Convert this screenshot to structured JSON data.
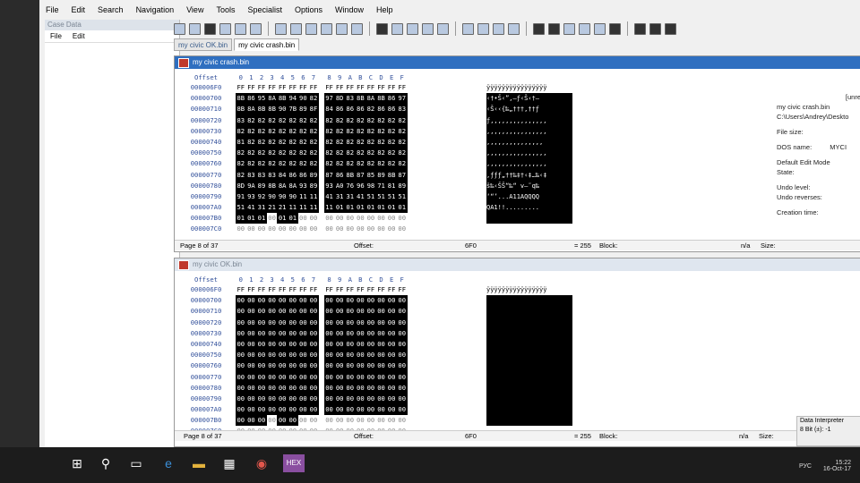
{
  "menu": [
    "File",
    "Edit",
    "Search",
    "Navigation",
    "View",
    "Tools",
    "Specialist",
    "Options",
    "Window",
    "Help"
  ],
  "sidebar": {
    "title": "Case Data",
    "menu": [
      "File",
      "Edit"
    ]
  },
  "tabs": [
    "my civic OK.bin",
    "my civic crash.bin"
  ],
  "top": {
    "title": "my civic crash.bin",
    "header": [
      "0",
      "1",
      "2",
      "3",
      "4",
      "5",
      "6",
      "7",
      "8",
      "9",
      "A",
      "B",
      "C",
      "D",
      "E",
      "F"
    ],
    "offset_label": "Offset",
    "rows": [
      {
        "off": "000006F0",
        "b": [
          "FF",
          "FF",
          "FF",
          "FF",
          "FF",
          "FF",
          "FF",
          "FF",
          "FF",
          "FF",
          "FF",
          "FF",
          "FF",
          "FF",
          "FF",
          "FF"
        ],
        "t": "ÿÿÿÿÿÿÿÿÿÿÿÿÿÿÿÿ"
      },
      {
        "off": "00000700",
        "b": [
          "8B",
          "86",
          "95",
          "8A",
          "8B",
          "94",
          "90",
          "82",
          "97",
          "8D",
          "83",
          "8B",
          "8A",
          "8B",
          "86",
          "97"
        ],
        "t": "‹†•Š‹”‚—ƒ‹Š‹†—"
      },
      {
        "off": "00000710",
        "b": [
          "8B",
          "8A",
          "8B",
          "8B",
          "90",
          "7B",
          "89",
          "8F",
          "84",
          "86",
          "86",
          "86",
          "82",
          "86",
          "86",
          "83"
        ],
        "t": "‹Š‹‹{‰„†††‚††ƒ"
      },
      {
        "off": "00000720",
        "b": [
          "83",
          "82",
          "82",
          "82",
          "82",
          "82",
          "82",
          "82",
          "82",
          "82",
          "82",
          "82",
          "82",
          "82",
          "82",
          "82"
        ],
        "t": "ƒ‚‚‚‚‚‚‚‚‚‚‚‚‚‚‚"
      },
      {
        "off": "00000730",
        "b": [
          "82",
          "82",
          "82",
          "82",
          "82",
          "82",
          "82",
          "82",
          "82",
          "82",
          "82",
          "82",
          "82",
          "82",
          "82",
          "82"
        ],
        "t": "‚‚‚‚‚‚‚‚‚‚‚‚‚‚‚‚"
      },
      {
        "off": "00000740",
        "b": [
          "81",
          "82",
          "82",
          "82",
          "82",
          "82",
          "82",
          "82",
          "82",
          "82",
          "82",
          "82",
          "82",
          "82",
          "82",
          "82"
        ],
        "t": "‚‚‚‚‚‚‚‚‚‚‚‚‚‚‚"
      },
      {
        "off": "00000750",
        "b": [
          "82",
          "82",
          "82",
          "82",
          "82",
          "82",
          "82",
          "82",
          "82",
          "82",
          "82",
          "82",
          "82",
          "82",
          "82",
          "82"
        ],
        "t": "‚‚‚‚‚‚‚‚‚‚‚‚‚‚‚‚"
      },
      {
        "off": "00000760",
        "b": [
          "82",
          "82",
          "82",
          "82",
          "82",
          "82",
          "82",
          "82",
          "82",
          "82",
          "82",
          "82",
          "82",
          "82",
          "82",
          "82"
        ],
        "t": "‚‚‚‚‚‚‚‚‚‚‚‚‚‚‚‚"
      },
      {
        "off": "00000770",
        "b": [
          "82",
          "83",
          "83",
          "83",
          "84",
          "86",
          "86",
          "89",
          "87",
          "86",
          "8B",
          "87",
          "85",
          "89",
          "8B",
          "87"
        ],
        "t": "‚ƒƒƒ„††‰‡†‹‡…‰‹‡"
      },
      {
        "off": "00000780",
        "b": [
          "8D",
          "9A",
          "89",
          "8B",
          "8A",
          "8A",
          "93",
          "89",
          "93",
          "A0",
          "76",
          "96",
          "98",
          "71",
          "81",
          "89"
        ],
        "t": "š‰‹ŠŠ“‰“ v–˜q‰"
      },
      {
        "off": "00000790",
        "b": [
          "91",
          "93",
          "92",
          "90",
          "90",
          "90",
          "11",
          "11",
          "41",
          "31",
          "31",
          "41",
          "51",
          "51",
          "51",
          "51"
        ],
        "t": "‘“’...A11AQQQQ"
      },
      {
        "off": "000007A0",
        "b": [
          "51",
          "41",
          "31",
          "21",
          "21",
          "11",
          "11",
          "11",
          "11",
          "01",
          "01",
          "01",
          "01",
          "01",
          "01",
          "01"
        ],
        "t": "QA1!!........."
      },
      {
        "off": "000007B0",
        "b": [
          "01",
          "01",
          "01",
          "00",
          "01",
          "01",
          "00",
          "00",
          "00",
          "00",
          "00",
          "00",
          "00",
          "00",
          "00",
          "00"
        ],
        "t": ""
      },
      {
        "off": "000007C0",
        "b": [
          "00",
          "00",
          "00",
          "00",
          "00",
          "00",
          "00",
          "00",
          "00",
          "00",
          "00",
          "00",
          "00",
          "00",
          "00",
          "00"
        ],
        "t": ""
      }
    ],
    "status": {
      "page": "Page 8 of 37",
      "offset_label": "Offset:",
      "offset_val": "6F0",
      "eq": "= 255",
      "block": "Block:",
      "na": "n/a",
      "size": "Size:"
    },
    "info": {
      "name": "my civic crash.bin",
      "path": "C:\\Users\\Andrey\\Deskto",
      "file_size": "File size:",
      "dos": "DOS name:",
      "dos_val": "MYCI",
      "mode": "Default Edit Mode",
      "state": "State:",
      "undo_level": "Undo level:",
      "undo_rev": "Undo reverses:",
      "creation": "Creation time:",
      "unre": "[unre"
    }
  },
  "bottom": {
    "title": "my civic OK.bin",
    "offset_label": "Offset",
    "header": [
      "0",
      "1",
      "2",
      "3",
      "4",
      "5",
      "6",
      "7",
      "8",
      "9",
      "A",
      "B",
      "C",
      "D",
      "E",
      "F"
    ],
    "rows": [
      {
        "off": "000006F0",
        "b": [
          "FF",
          "FF",
          "FF",
          "FF",
          "FF",
          "FF",
          "FF",
          "FF",
          "FF",
          "FF",
          "FF",
          "FF",
          "FF",
          "FF",
          "FF",
          "FF"
        ],
        "t": "ÿÿÿÿÿÿÿÿÿÿÿÿÿÿÿÿ"
      },
      {
        "off": "00000700",
        "b": [
          "00",
          "00",
          "00",
          "00",
          "00",
          "00",
          "00",
          "00",
          "00",
          "00",
          "00",
          "00",
          "00",
          "00",
          "00",
          "00"
        ],
        "t": ""
      },
      {
        "off": "00000710",
        "b": [
          "00",
          "00",
          "00",
          "00",
          "00",
          "00",
          "00",
          "00",
          "00",
          "00",
          "00",
          "00",
          "00",
          "00",
          "00",
          "00"
        ],
        "t": ""
      },
      {
        "off": "00000720",
        "b": [
          "00",
          "00",
          "00",
          "00",
          "00",
          "00",
          "00",
          "00",
          "00",
          "00",
          "00",
          "00",
          "00",
          "00",
          "00",
          "00"
        ],
        "t": ""
      },
      {
        "off": "00000730",
        "b": [
          "00",
          "00",
          "00",
          "00",
          "00",
          "00",
          "00",
          "00",
          "00",
          "00",
          "00",
          "00",
          "00",
          "00",
          "00",
          "00"
        ],
        "t": ""
      },
      {
        "off": "00000740",
        "b": [
          "00",
          "00",
          "00",
          "00",
          "00",
          "00",
          "00",
          "00",
          "00",
          "00",
          "00",
          "00",
          "00",
          "00",
          "00",
          "00"
        ],
        "t": ""
      },
      {
        "off": "00000750",
        "b": [
          "00",
          "00",
          "00",
          "00",
          "00",
          "00",
          "00",
          "00",
          "00",
          "00",
          "00",
          "00",
          "00",
          "00",
          "00",
          "00"
        ],
        "t": ""
      },
      {
        "off": "00000760",
        "b": [
          "00",
          "00",
          "00",
          "00",
          "00",
          "00",
          "00",
          "00",
          "00",
          "00",
          "00",
          "00",
          "00",
          "00",
          "00",
          "00"
        ],
        "t": ""
      },
      {
        "off": "00000770",
        "b": [
          "00",
          "00",
          "00",
          "00",
          "00",
          "00",
          "00",
          "00",
          "00",
          "00",
          "00",
          "00",
          "00",
          "00",
          "00",
          "00"
        ],
        "t": ""
      },
      {
        "off": "00000780",
        "b": [
          "00",
          "00",
          "00",
          "00",
          "00",
          "00",
          "00",
          "00",
          "00",
          "00",
          "00",
          "00",
          "00",
          "00",
          "00",
          "00"
        ],
        "t": ""
      },
      {
        "off": "00000790",
        "b": [
          "00",
          "00",
          "00",
          "00",
          "00",
          "00",
          "00",
          "00",
          "00",
          "00",
          "00",
          "00",
          "00",
          "00",
          "00",
          "00"
        ],
        "t": ""
      },
      {
        "off": "000007A0",
        "b": [
          "00",
          "00",
          "00",
          "00",
          "00",
          "00",
          "00",
          "00",
          "00",
          "00",
          "00",
          "00",
          "00",
          "00",
          "00",
          "00"
        ],
        "t": ""
      },
      {
        "off": "000007B0",
        "b": [
          "00",
          "00",
          "00",
          "00",
          "00",
          "00",
          "00",
          "00",
          "00",
          "00",
          "00",
          "00",
          "00",
          "00",
          "00",
          "00"
        ],
        "t": ""
      },
      {
        "off": "000007C0",
        "b": [
          "00",
          "00",
          "00",
          "00",
          "00",
          "00",
          "00",
          "00",
          "00",
          "00",
          "00",
          "00",
          "00",
          "00",
          "00",
          "00"
        ],
        "t": ""
      }
    ],
    "status": {
      "page": "Page 8 of 37",
      "offset_label": "Offset:",
      "offset_val": "6F0",
      "eq": "= 255",
      "block": "Block:",
      "na": "n/a",
      "size": "Size:"
    },
    "data_interpreter": "Data Interpreter",
    "bits": "8 Bit (±): -1"
  },
  "taskbar": {
    "lang": "РУС",
    "time": "15:22",
    "date": "16-Oct-17"
  }
}
